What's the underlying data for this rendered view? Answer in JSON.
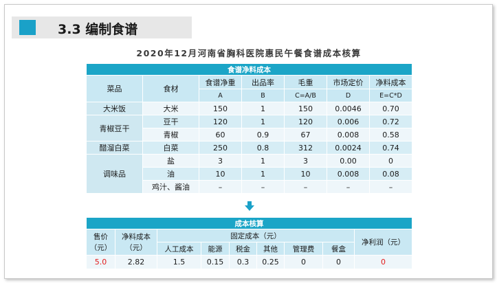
{
  "header": {
    "title": "3.3 编制食谱"
  },
  "document": {
    "title": "2020年12月河南省胸科医院惠民午餐食谱成本核算"
  },
  "net_cost_table": {
    "banner": "食谱净料成本",
    "headers": {
      "dish": "菜品",
      "ingredient": "食材",
      "net_weight": "食谱净重",
      "yield_rate": "出品率",
      "gross_weight": "毛重",
      "market_price": "市场定价",
      "net_cost": "净料成本"
    },
    "subheaders": {
      "net_weight": "A",
      "yield_rate": "B",
      "gross_weight": "C=A/B",
      "market_price": "D",
      "net_cost": "E=C*D"
    },
    "dishes": [
      "大米饭",
      "青椒豆干",
      "醋溜白菜",
      "调味品"
    ],
    "rows": [
      {
        "ingredient": "大米",
        "a": "150",
        "b": "1",
        "c": "150",
        "d": "0.0046",
        "e": "0.70"
      },
      {
        "ingredient": "豆干",
        "a": "120",
        "b": "1",
        "c": "120",
        "d": "0.006",
        "e": "0.72"
      },
      {
        "ingredient": "青椒",
        "a": "60",
        "b": "0.9",
        "c": "67",
        "d": "0.008",
        "e": "0.58"
      },
      {
        "ingredient": "白菜",
        "a": "250",
        "b": "0.8",
        "c": "312",
        "d": "0.0024",
        "e": "0.74"
      },
      {
        "ingredient": "盐",
        "a": "3",
        "b": "1",
        "c": "3",
        "d": "0.00",
        "e": "0"
      },
      {
        "ingredient": "油",
        "a": "10",
        "b": "1",
        "c": "10",
        "d": "0.008",
        "e": "0.08"
      },
      {
        "ingredient": "鸡汁、酱油",
        "a": "–",
        "b": "–",
        "c": "–",
        "d": "–",
        "e": "–"
      }
    ]
  },
  "arrow_icon": "arrow-down-icon",
  "cost_table": {
    "banner": "成本核算",
    "headers": {
      "price": "售价（元）",
      "net_cost": "净料成本（元）",
      "fixed_cost": "固定成本（元）",
      "net_profit": "净利润（元）"
    },
    "fixed_items": [
      "人工成本",
      "能源",
      "税金",
      "其他",
      "管理费",
      "餐盒"
    ],
    "values": {
      "price": "5.0",
      "net_cost": "2.82",
      "fixed": [
        "1.5",
        "0.15",
        "0.3",
        "0.25",
        "0",
        "0"
      ],
      "net_profit": "0"
    }
  },
  "colors": {
    "accent": "#1aa1c8",
    "banner": "#1ba5c7",
    "header_bg": "#c9e8f3",
    "row_light": "#eef6fa",
    "row_dark": "#d6edf5",
    "highlight_red": "#e21b1b"
  }
}
